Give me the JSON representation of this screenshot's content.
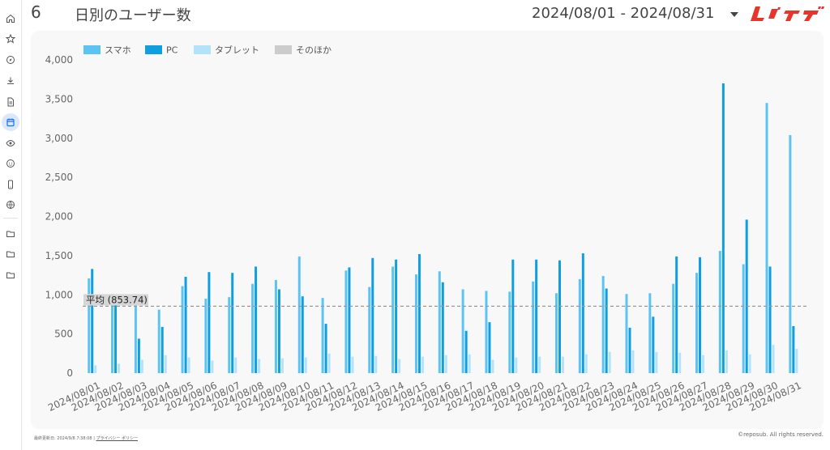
{
  "sidebar": {
    "items": [
      {
        "icon": "home-icon"
      },
      {
        "icon": "star-icon"
      },
      {
        "icon": "compass-icon"
      },
      {
        "icon": "download-icon"
      },
      {
        "icon": "document-icon"
      },
      {
        "icon": "calendar-icon",
        "active": true
      },
      {
        "icon": "eye-icon"
      },
      {
        "icon": "face-icon"
      },
      {
        "icon": "smartphone-icon"
      },
      {
        "icon": "globe-icon"
      },
      {
        "icon": "folder-icon"
      },
      {
        "icon": "folder-icon"
      },
      {
        "icon": "folder-icon"
      }
    ]
  },
  "header": {
    "page_number": "6",
    "title": "日別のユーザー数",
    "date_range": "2024/08/01 - 2024/08/31",
    "logo_text": "レポサブ"
  },
  "colors": {
    "smartphone": "#5bc4f2",
    "pc": "#0f9ee0",
    "tablet": "#b3e3fb",
    "other": "#cccccc",
    "average_line": "#9a9a9a",
    "active_sidebar": "#dbe8fb"
  },
  "chart_data": {
    "type": "bar",
    "legend_position": "top-left",
    "grid": false,
    "ylim": [
      0,
      4000
    ],
    "yticks": [
      "0",
      "500",
      "1,000",
      "1,500",
      "2,000",
      "2,500",
      "3,000",
      "3,500",
      "4,000"
    ],
    "categories": [
      "2024/08/01",
      "2024/08/02",
      "2024/08/03",
      "2024/08/04",
      "2024/08/05",
      "2024/08/06",
      "2024/08/07",
      "2024/08/08",
      "2024/08/09",
      "2024/08/10",
      "2024/08/11",
      "2024/08/12",
      "2024/08/13",
      "2024/08/14",
      "2024/08/15",
      "2024/08/16",
      "2024/08/17",
      "2024/08/18",
      "2024/08/19",
      "2024/08/20",
      "2024/08/21",
      "2024/08/22",
      "2024/08/23",
      "2024/08/24",
      "2024/08/25",
      "2024/08/26",
      "2024/08/27",
      "2024/08/28",
      "2024/08/29",
      "2024/08/30",
      "2024/08/31"
    ],
    "series": [
      {
        "name": "スマホ",
        "values": [
          1210,
          1010,
          1000,
          810,
          1110,
          950,
          970,
          1140,
          1190,
          1490,
          960,
          1310,
          1100,
          1360,
          1260,
          1300,
          1070,
          1050,
          1040,
          1170,
          1020,
          1200,
          1240,
          1010,
          1020,
          1140,
          1280,
          1560,
          1390,
          3450,
          3040
        ]
      },
      {
        "name": "PC",
        "values": [
          1330,
          980,
          440,
          590,
          1230,
          1290,
          1280,
          1360,
          1070,
          980,
          630,
          1350,
          1470,
          1450,
          1520,
          1160,
          540,
          650,
          1450,
          1450,
          1440,
          1530,
          1080,
          580,
          720,
          1490,
          1480,
          3700,
          1960,
          1360,
          600
        ]
      },
      {
        "name": "タブレット",
        "values": [
          100,
          120,
          170,
          230,
          200,
          160,
          200,
          180,
          190,
          200,
          250,
          210,
          220,
          180,
          210,
          230,
          240,
          170,
          200,
          210,
          210,
          240,
          270,
          290,
          270,
          260,
          230,
          290,
          240,
          360,
          310
        ]
      },
      {
        "name": "そのほか",
        "values": [
          0,
          0,
          0,
          0,
          0,
          0,
          0,
          0,
          0,
          0,
          0,
          0,
          0,
          0,
          0,
          0,
          0,
          0,
          0,
          0,
          0,
          0,
          0,
          0,
          0,
          0,
          0,
          0,
          0,
          0,
          0
        ]
      }
    ],
    "average": {
      "label": "平均 (853.74)",
      "value": 853.74
    }
  },
  "footer": {
    "last_updated": "最終更新日: 2024/9/8 7:38:08",
    "separator": "|",
    "privacy_link": "プライバシー ポリシー",
    "copyright": "©reposub. All rights reserved."
  }
}
